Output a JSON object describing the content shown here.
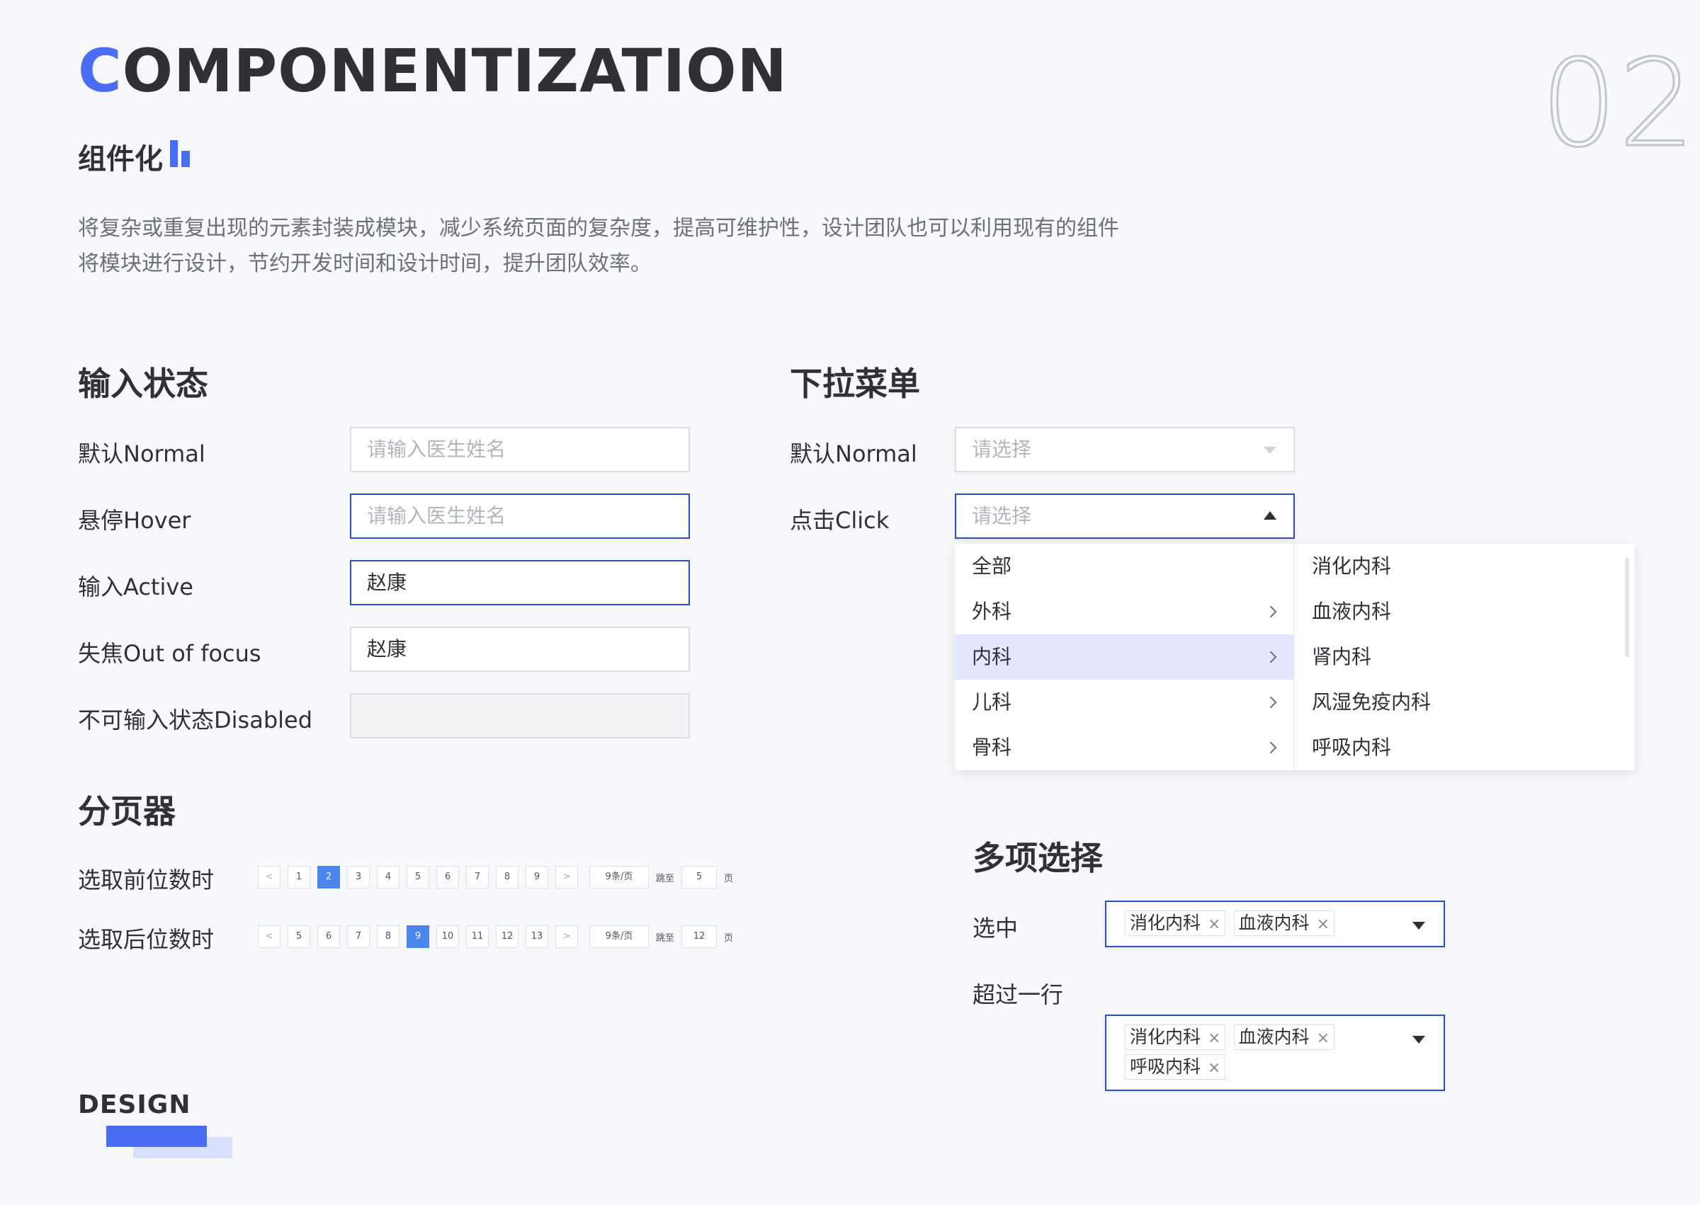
{
  "header": {
    "title_first": "C",
    "title_rest": "OMPONENTIZATION",
    "number": "02",
    "subtitle": "组件化",
    "desc_line1": "将复杂或重复出现的元素封装成模块，减少系统页面的复杂度，提高可维护性，设计团队也可以利用现有的组件",
    "desc_line2": "将模块进行设计，节约开发时间和设计时间，提升团队效率。"
  },
  "input_states": {
    "heading": "输入状态",
    "rows": [
      {
        "label": "默认Normal",
        "text": "请输入医生姓名"
      },
      {
        "label": "悬停Hover",
        "text": "请输入医生姓名"
      },
      {
        "label": "输入Active",
        "text": "赵康"
      },
      {
        "label": "失焦Out of focus",
        "text": "赵康"
      },
      {
        "label": "不可输入状态Disabled",
        "text": ""
      }
    ]
  },
  "dropdown": {
    "heading": "下拉菜单",
    "normal_label": "默认Normal",
    "click_label": "点击Click",
    "placeholder": "请选择",
    "left_options": [
      "全部",
      "外科",
      "内科",
      "儿科",
      "骨科"
    ],
    "right_options": [
      "消化内科",
      "血液内科",
      "肾内科",
      "风湿免疫内科",
      "呼吸内科"
    ]
  },
  "pagination": {
    "heading": "分页器",
    "row1_label": "选取前位数时",
    "row1_pages": [
      "1",
      "2",
      "3",
      "4",
      "5",
      "6",
      "7",
      "8",
      "9"
    ],
    "row1_current": "2",
    "row1_jump": "5",
    "row2_label": "选取后位数时",
    "row2_pages": [
      "5",
      "6",
      "7",
      "8",
      "9",
      "10",
      "11",
      "12",
      "13"
    ],
    "row2_current": "9",
    "row2_jump": "12",
    "prev": "<",
    "next": ">",
    "page_size": "9条/页",
    "jump_to": "跳至",
    "page_unit": "页"
  },
  "multi_select": {
    "heading": "多项选择",
    "selected_label": "选中",
    "overflow_label": "超过一行",
    "selected_tags": [
      "消化内科",
      "血液内科"
    ],
    "overflow_tags": [
      "消化内科",
      "血液内科",
      "呼吸内科"
    ],
    "remove_glyph": "×"
  },
  "footer": {
    "design": "DESIGN"
  },
  "colors": {
    "accent": "#4a6cf7",
    "focus_border": "#2e4ccf",
    "page_current": "#4a86f0",
    "option_selected_bg": "#e1e8fd"
  }
}
